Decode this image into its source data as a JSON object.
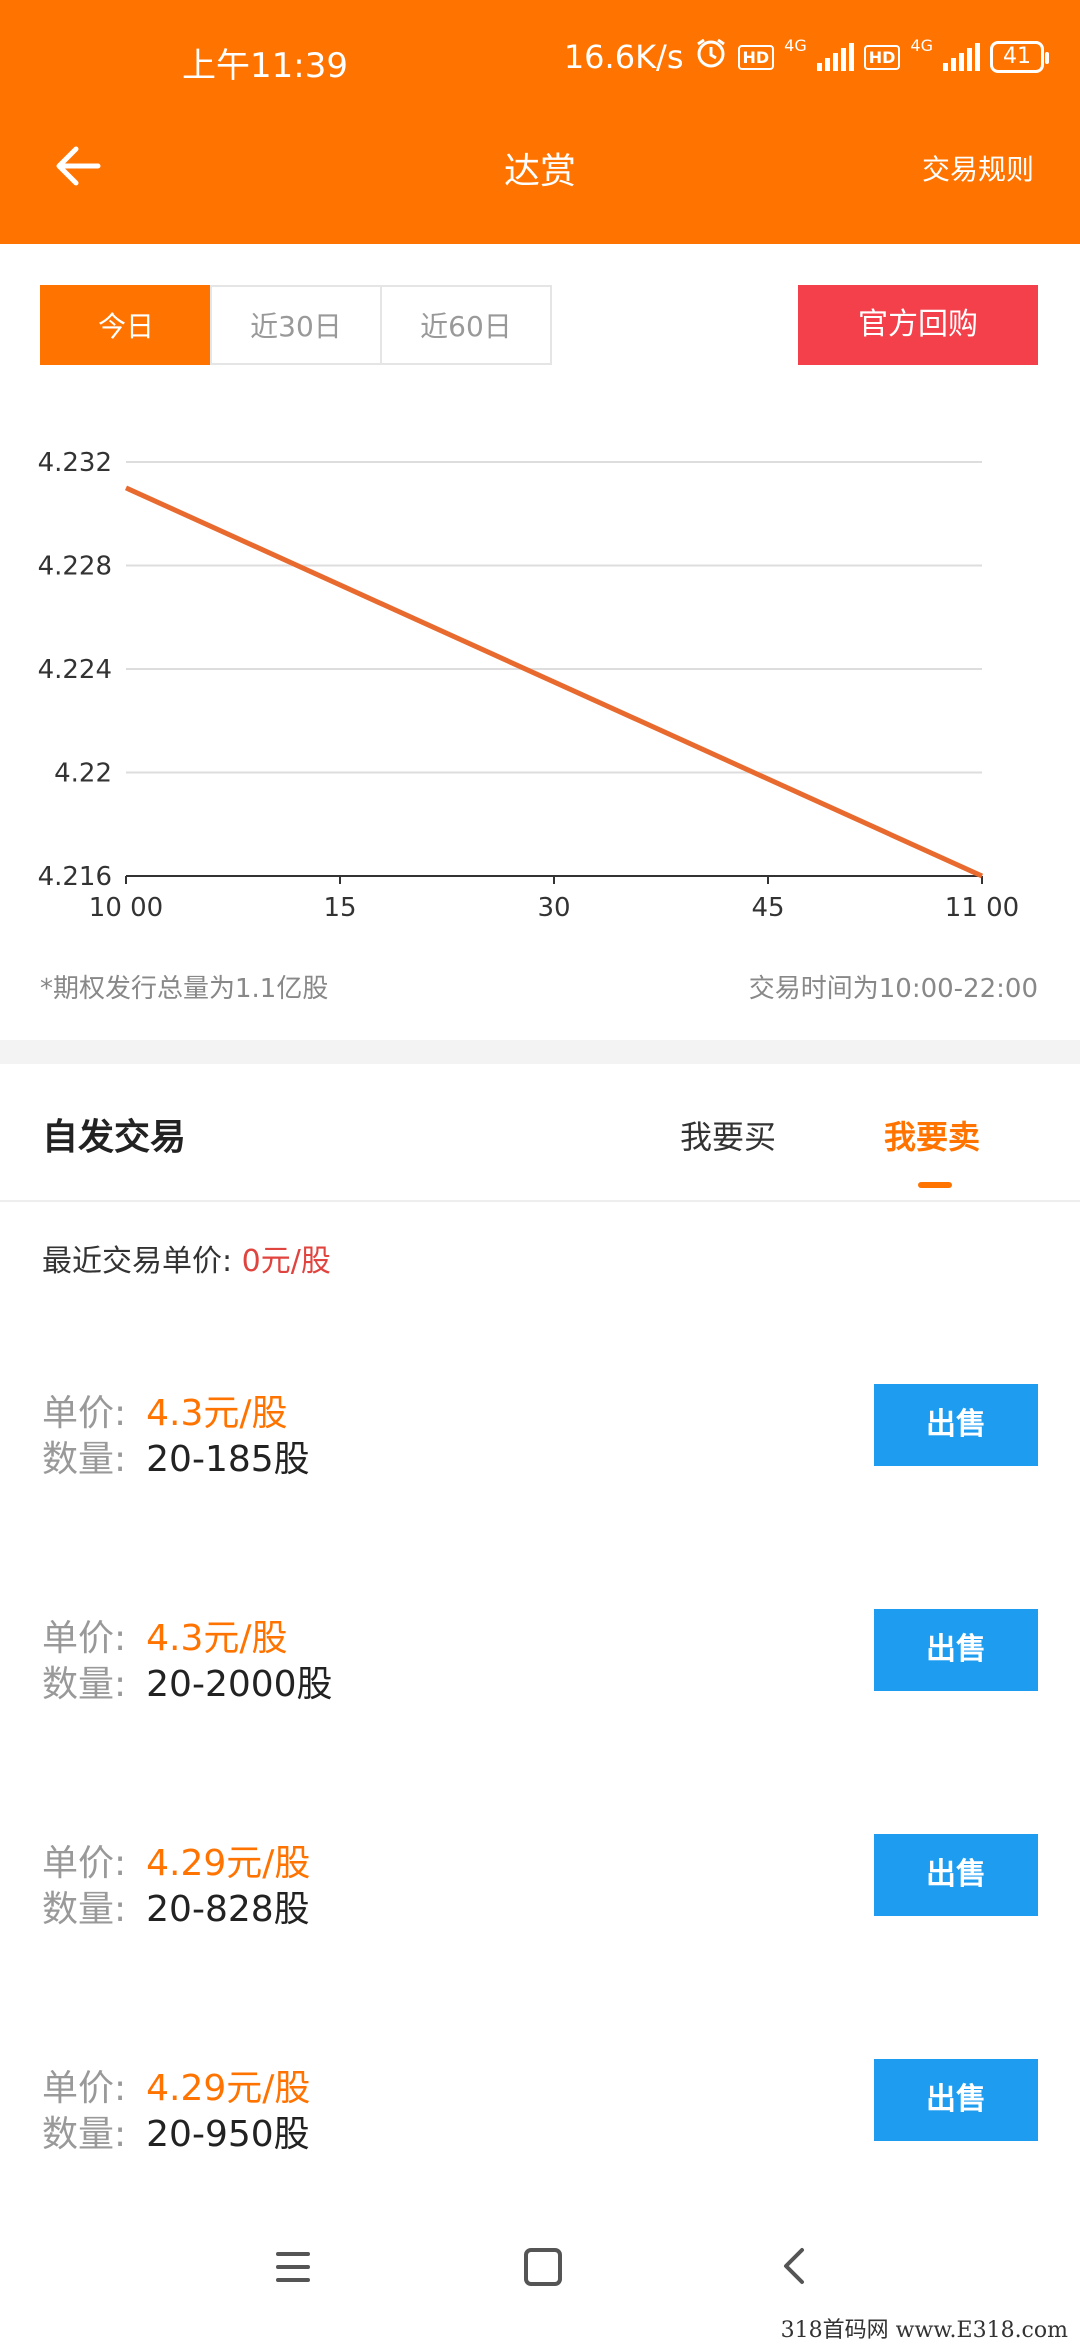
{
  "status_bar": {
    "time": "上午11:39",
    "network_speed": "16.6K/s",
    "hd_badge": "HD",
    "signal_label": "4G",
    "battery": "41"
  },
  "header": {
    "title": "达赏",
    "rules_link": "交易规则",
    "background_color": "#ff7300"
  },
  "range_tabs": [
    {
      "label": "今日",
      "active": true
    },
    {
      "label": "近30日",
      "active": false
    },
    {
      "label": "近60日",
      "active": false
    }
  ],
  "buyback_button": "官方回购",
  "chart_data": {
    "type": "line",
    "x": [
      "10 00",
      "11 00"
    ],
    "x_ticks": [
      "10 00",
      "15",
      "30",
      "45",
      "11 00"
    ],
    "y_ticks": [
      "4.232",
      "4.228",
      "4.224",
      "4.22",
      "4.216"
    ],
    "ylim": [
      4.216,
      4.232
    ],
    "series": [
      {
        "x_minutes": [
          0,
          60
        ],
        "values": [
          4.231,
          4.216
        ],
        "color": "#e86a2e"
      }
    ],
    "grid": true
  },
  "footnotes": {
    "left": "*期权发行总量为1.1亿股",
    "right": "交易时间为10:00-22:00"
  },
  "trade": {
    "title": "自发交易",
    "tab_buy": "我要买",
    "tab_sell": "我要卖",
    "recent_label": "最近交易单价:",
    "recent_value": "0元/股",
    "price_label": "单价:",
    "qty_label": "数量:",
    "sell_button": "出售",
    "listings": [
      {
        "price": "4.3元/股",
        "qty": "20-185股"
      },
      {
        "price": "4.3元/股",
        "qty": "20-2000股"
      },
      {
        "price": "4.29元/股",
        "qty": "20-828股"
      },
      {
        "price": "4.29元/股",
        "qty": "20-950股"
      }
    ]
  },
  "watermark": "318首码网 www.E318.com"
}
